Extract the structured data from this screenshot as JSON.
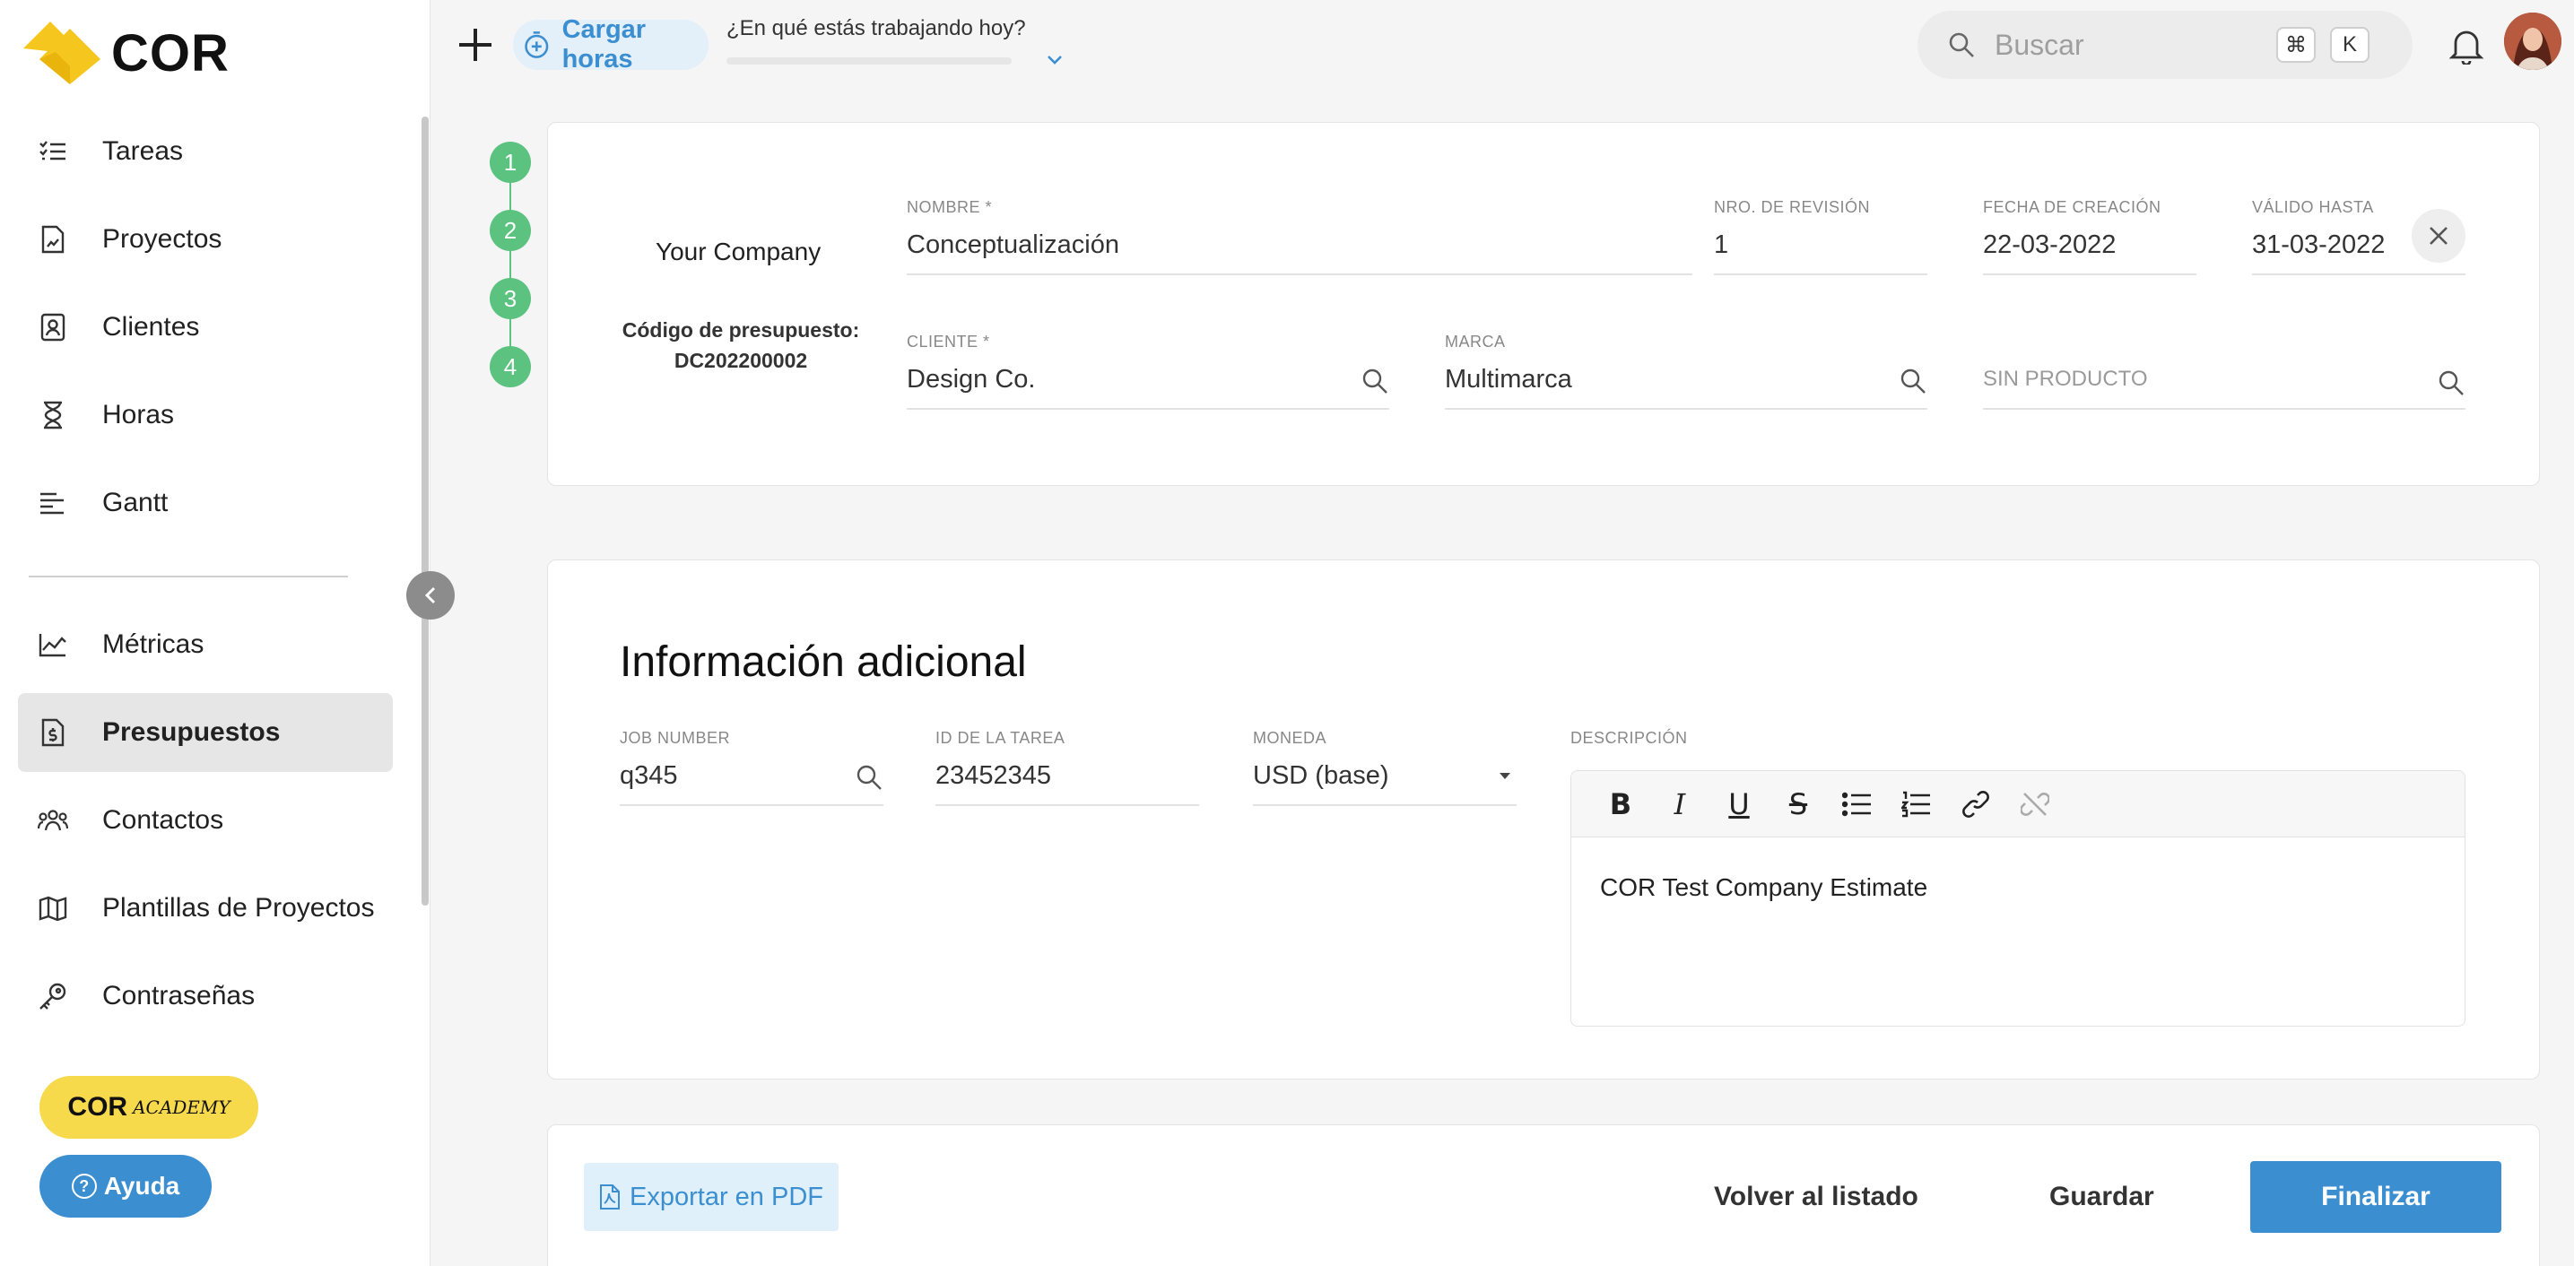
{
  "brand": {
    "name": "COR",
    "accent_color": "#3b8ed0",
    "logo_color": "#f5c61d"
  },
  "sidebar": {
    "items": [
      {
        "label": "Tareas",
        "icon": "task-list-icon"
      },
      {
        "label": "Proyectos",
        "icon": "project-file-icon"
      },
      {
        "label": "Clientes",
        "icon": "client-card-icon"
      },
      {
        "label": "Horas",
        "icon": "hourglass-icon"
      },
      {
        "label": "Gantt",
        "icon": "gantt-icon"
      },
      {
        "label": "Métricas",
        "icon": "metrics-chart-icon"
      },
      {
        "label": "Presupuestos",
        "icon": "budget-icon",
        "active": true
      },
      {
        "label": "Contactos",
        "icon": "contacts-icon"
      },
      {
        "label": "Plantillas de Proyectos",
        "icon": "template-map-icon"
      },
      {
        "label": "Contraseñas",
        "icon": "key-icon"
      }
    ],
    "academy": {
      "main": "COR",
      "small": "ACADEMY"
    },
    "help_label": "Ayuda"
  },
  "topbar": {
    "cargar_label": "Cargar horas",
    "working_prompt": "¿En qué estás trabajando hoy?",
    "search_placeholder": "Buscar",
    "kbd_cmd": "⌘",
    "kbd_k": "K"
  },
  "steps": [
    "1",
    "2",
    "3",
    "4"
  ],
  "header_card": {
    "company": "Your Company",
    "code_label": "Código de presupuesto:",
    "code_value": "DC202200002",
    "fields": {
      "nombre": {
        "label": "NOMBRE *",
        "value": "Conceptualización"
      },
      "revision": {
        "label": "NRO. DE REVISIÓN",
        "value": "1"
      },
      "fecha_creacion": {
        "label": "FECHA DE CREACIÓN",
        "value": "22-03-2022"
      },
      "valido_hasta": {
        "label": "VÁLIDO HASTA",
        "value": "31-03-2022"
      },
      "cliente": {
        "label": "CLIENTE *",
        "value": "Design Co."
      },
      "marca": {
        "label": "MARCA",
        "value": "Multimarca"
      },
      "producto": {
        "placeholder": "SIN PRODUCTO"
      }
    }
  },
  "additional": {
    "title": "Información adicional",
    "job_number": {
      "label": "JOB NUMBER",
      "value": "q345"
    },
    "task_id": {
      "label": "ID DE LA TAREA",
      "value": "23452345"
    },
    "currency": {
      "label": "MONEDA",
      "value": "USD (base)"
    },
    "description": {
      "label": "DESCRIPCIÓN",
      "value": "COR Test Company Estimate"
    }
  },
  "footer": {
    "export_label": "Exportar en PDF",
    "back_label": "Volver al listado",
    "save_label": "Guardar",
    "finalize_label": "Finalizar"
  }
}
